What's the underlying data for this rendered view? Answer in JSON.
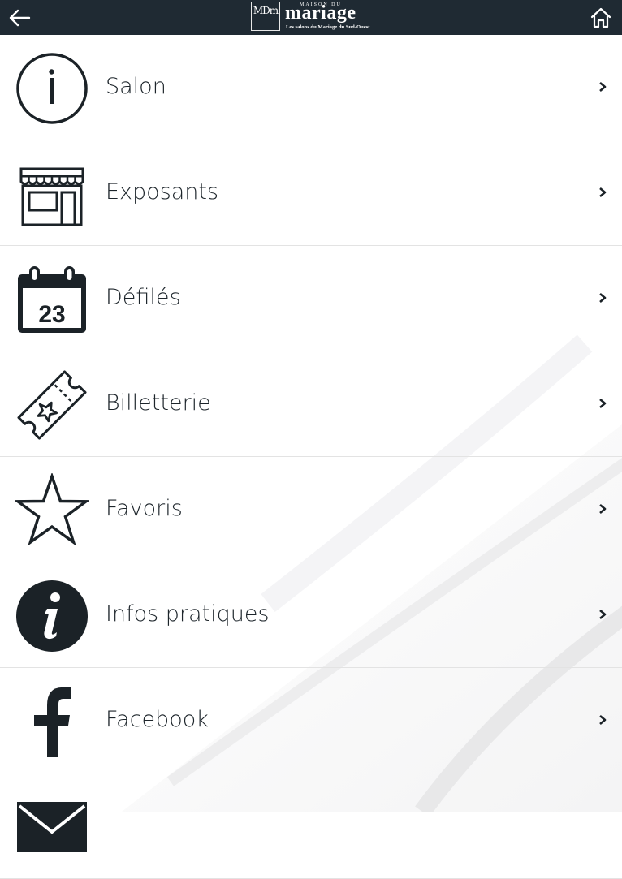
{
  "header": {
    "back_icon": "arrow-left-icon",
    "home_icon": "home-icon",
    "logo": {
      "mark": "MDm",
      "top_text": "MAISON DU",
      "word": "mariage",
      "tagline": "Les salons du Mariage du Sud-Ouest"
    }
  },
  "menu": {
    "items": [
      {
        "label": "Salon",
        "icon": "info-circle-outline-icon"
      },
      {
        "label": "Exposants",
        "icon": "storefront-icon"
      },
      {
        "label": "Défilés",
        "icon": "calendar-icon",
        "icon_text": "23"
      },
      {
        "label": "Billetterie",
        "icon": "ticket-icon"
      },
      {
        "label": "Favoris",
        "icon": "star-icon"
      },
      {
        "label": "Infos pratiques",
        "icon": "info-circle-filled-icon"
      },
      {
        "label": "Facebook",
        "icon": "facebook-icon"
      },
      {
        "label": "",
        "icon": "envelope-icon"
      }
    ],
    "chevron_icon": "chevron-right-icon"
  },
  "colors": {
    "header_bg": "#1f2a33",
    "icon": "#1b2227",
    "text": "#1d252b",
    "divider": "#e3e3e3"
  }
}
